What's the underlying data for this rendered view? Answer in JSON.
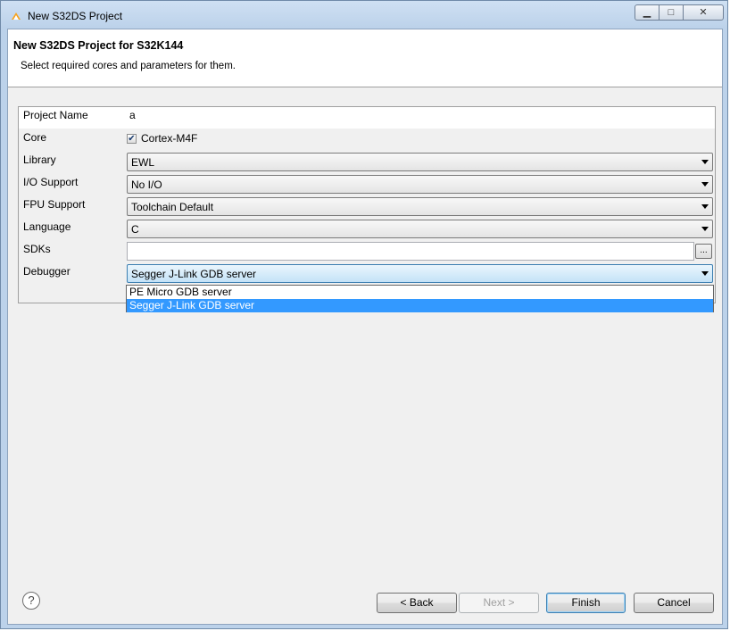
{
  "window": {
    "title": "New S32DS Project",
    "minimize_icon": "minimize-icon",
    "maximize_icon": "maximize-icon",
    "close_icon": "close-icon"
  },
  "header": {
    "title": "New S32DS Project for S32K144",
    "description": "Select required cores and parameters for them."
  },
  "form": {
    "project_name_label": "Project Name",
    "project_name_value": "a",
    "core_label": "Core",
    "core_checked": true,
    "core_value": "Cortex-M4F",
    "library_label": "Library",
    "library_value": "EWL",
    "io_support_label": "I/O Support",
    "io_support_value": "No I/O",
    "fpu_support_label": "FPU Support",
    "fpu_support_value": "Toolchain Default",
    "language_label": "Language",
    "language_value": "C",
    "sdks_label": "SDKs",
    "sdks_value": "",
    "sdks_browse_label": "...",
    "debugger_label": "Debugger",
    "debugger_value": "Segger J-Link GDB server"
  },
  "debugger_options": [
    {
      "label": "PE Micro GDB server",
      "selected": false
    },
    {
      "label": "Segger J-Link GDB server",
      "selected": true
    }
  ],
  "footer": {
    "help_label": "?",
    "back_label": "< Back",
    "next_label": "Next >",
    "finish_label": "Finish",
    "cancel_label": "Cancel"
  },
  "colors": {
    "selection": "#3399ff",
    "title_bar": "#bcd2ea"
  }
}
